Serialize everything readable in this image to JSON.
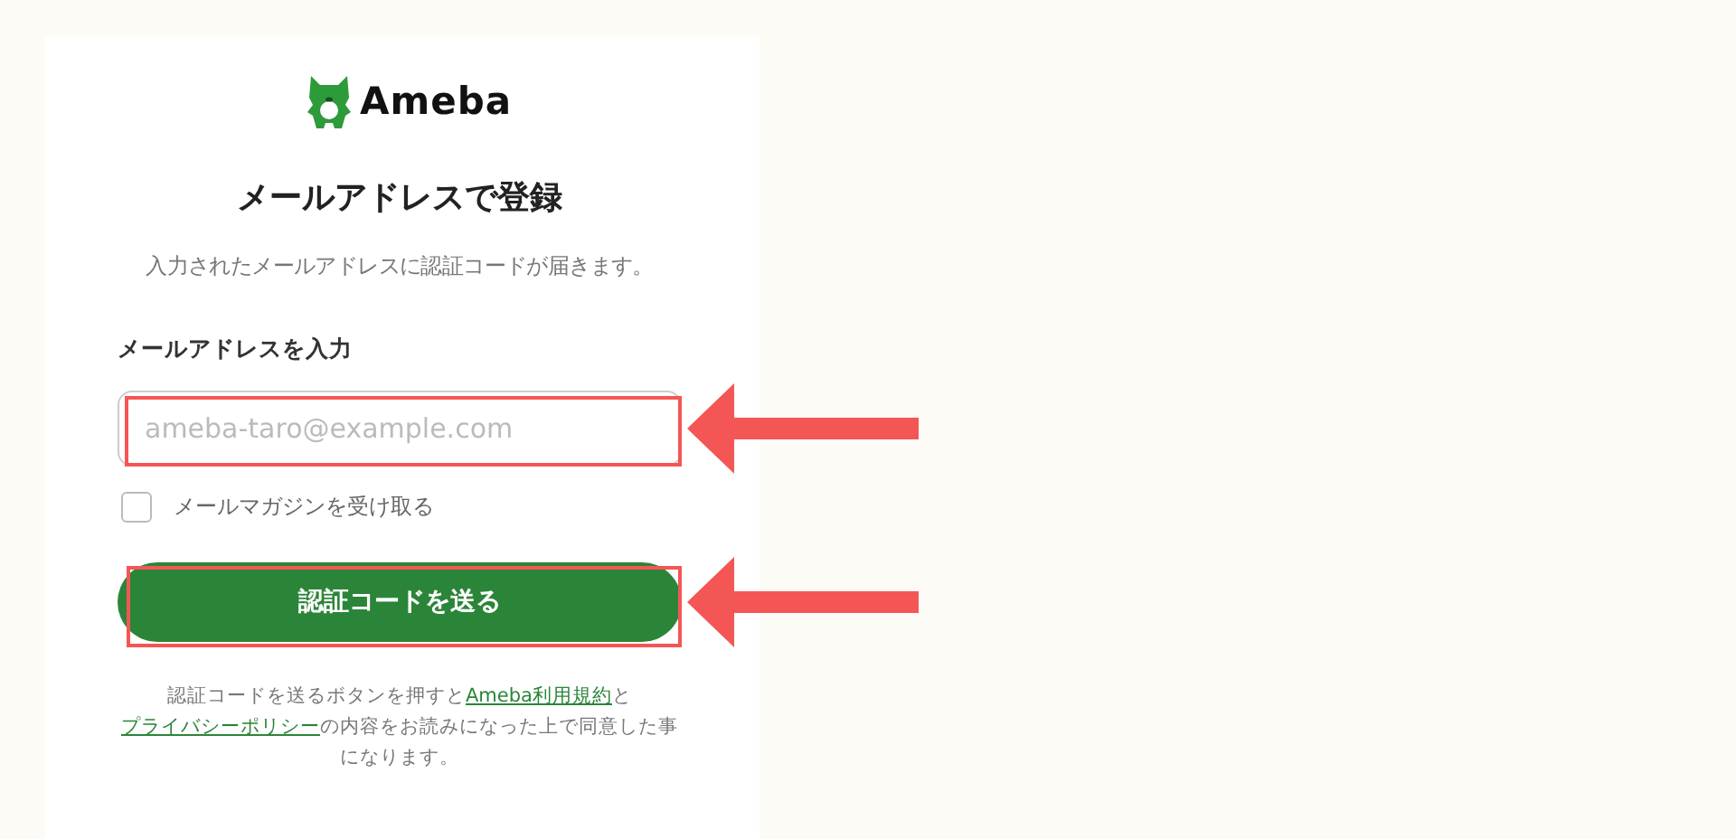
{
  "logo": {
    "text": "Ameba"
  },
  "title": "メールアドレスで登録",
  "subtitle": "入力されたメールアドレスに認証コードが届きます。",
  "email_field": {
    "label": "メールアドレスを入力",
    "placeholder": "ameba-taro@example.com",
    "highlighted": true
  },
  "newsletter": {
    "label": "メールマガジンを受け取る",
    "checked": false
  },
  "submit_button": {
    "label": "認証コードを送る",
    "highlighted": true
  },
  "notice": {
    "before": "認証コードを送るボタンを押すと",
    "terms_link": "Ameba利用規約",
    "middle": "と",
    "privacy_link": "プライバシーポリシー",
    "after": "の内容をお読みになった上で同意した事になります。"
  }
}
